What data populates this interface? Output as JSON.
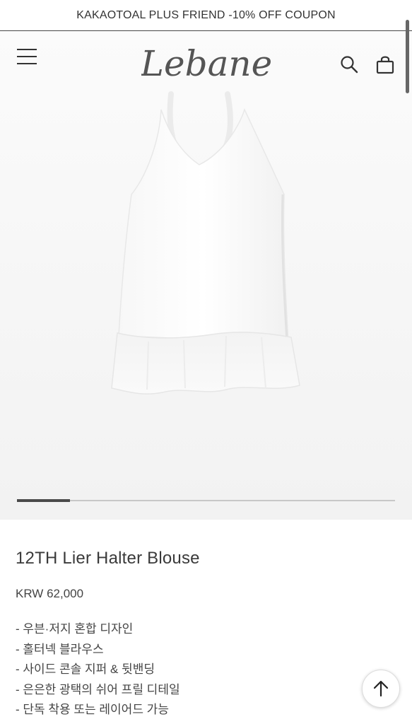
{
  "announcement": {
    "text": "KAKAOTOAL PLUS FRIEND -10% OFF COUPON"
  },
  "header": {
    "logo_text": "Lebane",
    "icons": [
      "menu-icon",
      "search-icon",
      "shopping-bag-icon"
    ]
  },
  "gallery": {
    "image_alt": "white halter blouse with ruffle hem",
    "slider_progress": 0.14
  },
  "product": {
    "title": "12TH Lier Halter Blouse",
    "price": "KRW 62,000",
    "features": [
      "- 우븐·저지 혼합 디자인",
      "- 홀터넥 블라우스",
      "- 사이드 콘솔 지퍼 & 뒷밴딩",
      "- 은은한 광택의 쉬어 프릴 디테일",
      "- 단독 착용 또는 레이어드 가능"
    ]
  },
  "floating": {
    "scroll_top_icon": "arrow-up-icon"
  }
}
